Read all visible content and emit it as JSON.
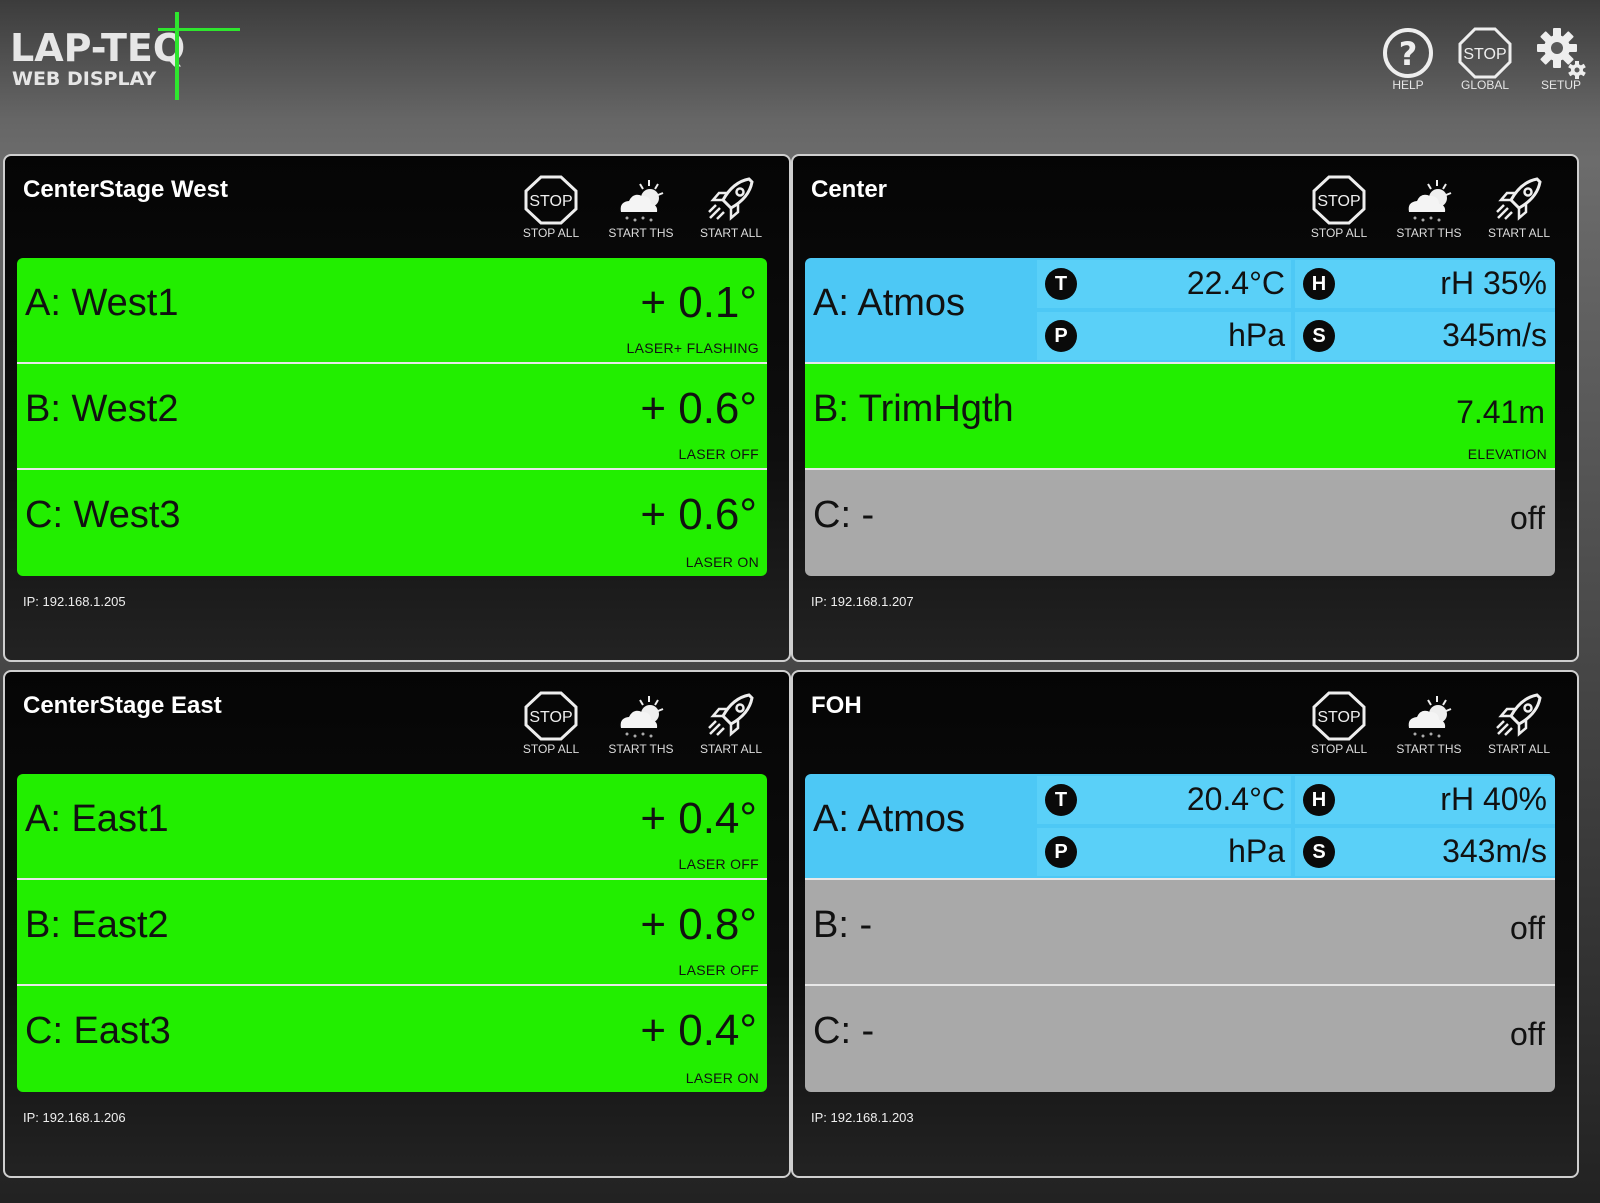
{
  "header": {
    "logo_line1": "LAP-TEQ",
    "logo_line2": "WEB DISPLAY",
    "help_label": "HELP",
    "global_stop_sign": "STOP",
    "global_label": "GLOBAL",
    "setup_label": "SETUP"
  },
  "colors": {
    "laser_active": "#22ee00",
    "atmos": "#4dc8f5",
    "off": "#a9a9a9",
    "logo_accent": "#2ee62e"
  },
  "panels": [
    {
      "title": "CenterStage West",
      "stop_sign": "STOP",
      "stop_label": "STOP ALL",
      "start_ths_label": "START THS",
      "start_all_label": "START ALL",
      "ip": "IP: 192.168.1.205",
      "rows": [
        {
          "label": "A: West1",
          "value": "+ 0.1°",
          "status": "LASER+ FLASHING"
        },
        {
          "label": "B: West2",
          "value": "+ 0.6°",
          "status": "LASER OFF"
        },
        {
          "label": "C: West3",
          "value": "+ 0.6°",
          "status": "LASER ON"
        }
      ]
    },
    {
      "title": "Center",
      "stop_sign": "STOP",
      "stop_label": "STOP ALL",
      "start_ths_label": "START THS",
      "start_all_label": "START ALL",
      "ip": "IP: 192.168.1.207",
      "atmos": {
        "label": "A: Atmos",
        "t_badge": "T",
        "temp": "22.4°C",
        "h_badge": "H",
        "humidity": "rH 35%",
        "p_badge": "P",
        "pressure": "hPa",
        "s_badge": "S",
        "sound": "345m/s"
      },
      "rows": [
        {
          "label": "B: TrimHgth",
          "value": "7.41m",
          "status": "ELEVATION"
        },
        {
          "label": "C: -",
          "value": "off",
          "status": ""
        }
      ]
    },
    {
      "title": "CenterStage East",
      "stop_sign": "STOP",
      "stop_label": "STOP ALL",
      "start_ths_label": "START THS",
      "start_all_label": "START ALL",
      "ip": "IP: 192.168.1.206",
      "rows": [
        {
          "label": "A: East1",
          "value": "+ 0.4°",
          "status": "LASER OFF"
        },
        {
          "label": "B: East2",
          "value": "+ 0.8°",
          "status": "LASER OFF"
        },
        {
          "label": "C: East3",
          "value": "+ 0.4°",
          "status": "LASER ON"
        }
      ]
    },
    {
      "title": "FOH",
      "stop_sign": "STOP",
      "stop_label": "STOP ALL",
      "start_ths_label": "START THS",
      "start_all_label": "START ALL",
      "ip": "IP: 192.168.1.203",
      "atmos": {
        "label": "A: Atmos",
        "t_badge": "T",
        "temp": "20.4°C",
        "h_badge": "H",
        "humidity": "rH 40%",
        "p_badge": "P",
        "pressure": "hPa",
        "s_badge": "S",
        "sound": "343m/s"
      },
      "rows": [
        {
          "label": "B: -",
          "value": "off",
          "status": ""
        },
        {
          "label": "C: -",
          "value": "off",
          "status": ""
        }
      ]
    }
  ]
}
